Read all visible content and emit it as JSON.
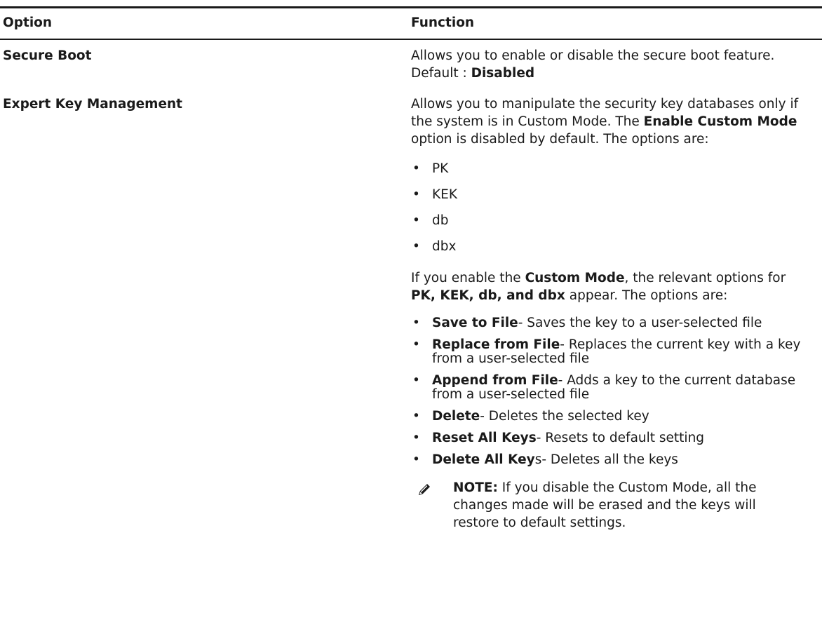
{
  "table": {
    "headers": {
      "option": "Option",
      "function": "Function"
    },
    "rows": [
      {
        "option": "Secure Boot",
        "desc_prefix": "Allows you to enable or disable the secure boot feature. Default : ",
        "desc_default": "Disabled"
      },
      {
        "option": "Expert Key Management",
        "p1_a": "Allows you to manipulate the security key databases only if the system is in Custom Mode. The ",
        "p1_b": "Enable Custom Mode",
        "p1_c": " option is disabled by default. The options are:",
        "list1": [
          "PK",
          "KEK",
          "db",
          "dbx"
        ],
        "p2_a": "If you enable the ",
        "p2_b": "Custom Mode",
        "p2_c": ", the relevant options for ",
        "p2_d": "PK, KEK, db, and dbx",
        "p2_e": " appear. The options are:",
        "list2": [
          {
            "bold": "Save to File",
            "text": "- Saves the key to a user-selected file"
          },
          {
            "bold": "Replace from File",
            "text": "- Replaces the current key with a key from a user-selected file"
          },
          {
            "bold": "Append from File",
            "text": "- Adds a key to the current database from a user-selected file"
          },
          {
            "bold": "Delete",
            "text": "- Deletes the selected key"
          },
          {
            "bold": "Reset All Keys",
            "text": "- Resets to default setting"
          },
          {
            "bold": "Delete All Key",
            "text": "s- Deletes all the keys"
          }
        ],
        "note_label": "NOTE:",
        "note_text": " If you disable the Custom Mode, all the changes made will be erased and the keys will restore to default settings.",
        "note_icon": "pencil-icon"
      }
    ]
  }
}
